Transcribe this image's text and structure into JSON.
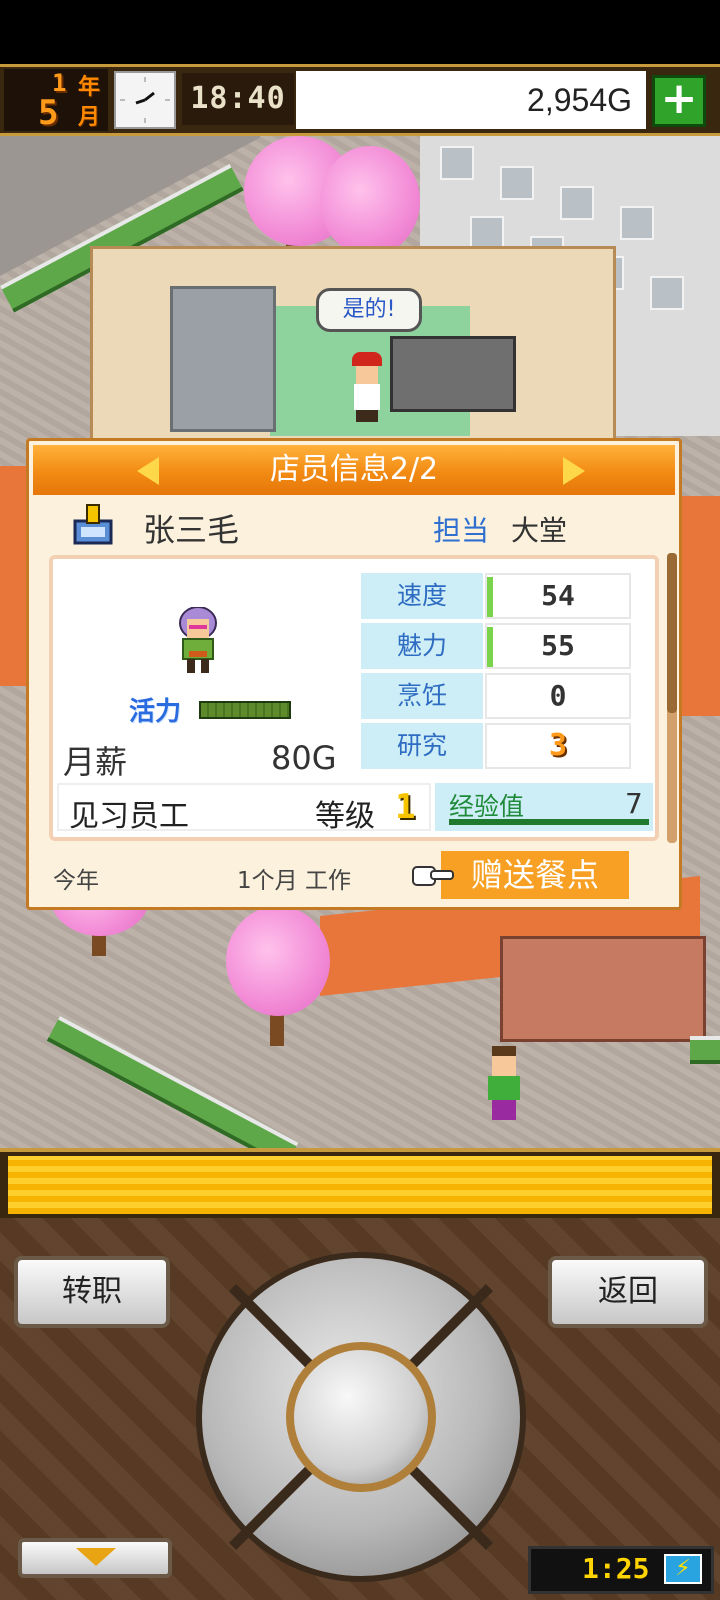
{
  "hud": {
    "year_num": "1",
    "year_unit": "年",
    "month_num": "5",
    "month_unit": "月",
    "time": "18:40",
    "money": "2,954G",
    "add_money_icon": "plus-icon"
  },
  "scene": {
    "speech_bubble": "是的!"
  },
  "staff_panel": {
    "title": "店员信息2/2",
    "name": "张三毛",
    "role_label": "担当",
    "role_value": "大堂",
    "vitality_label": "活力",
    "vitality_level": 1.0,
    "salary_label": "月薪",
    "salary_value": "80G",
    "stats": [
      {
        "name": "速度",
        "value": "54",
        "bar": 0.04
      },
      {
        "name": "魅力",
        "value": "55",
        "bar": 0.04
      },
      {
        "name": "烹饪",
        "value": "0",
        "bar": 0
      },
      {
        "name": "研究",
        "value": "3",
        "bar": 0
      }
    ],
    "staff_title": "见习员工",
    "level_label": "等级",
    "level_value": "1",
    "exp_label": "经验值",
    "exp_value": "7",
    "year_label": "今年",
    "tenure": "1个月 工作",
    "give_meal": "赠送餐点"
  },
  "controls": {
    "job_change": "转职",
    "back": "返回",
    "battery_time": "1:25"
  },
  "colors": {
    "header_orange": "#f28b13",
    "hud_brown": "#3a2710",
    "stat_label_bg": "#cdeef6",
    "meal_button": "#f7a023"
  }
}
